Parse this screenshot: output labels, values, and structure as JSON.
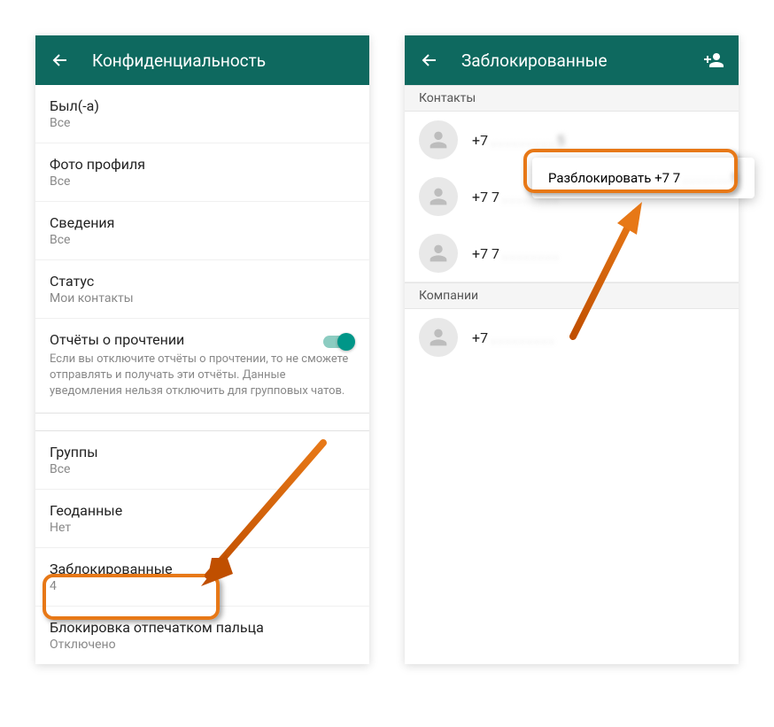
{
  "left": {
    "title": "Конфиденциальность",
    "items": {
      "lastSeen": {
        "title": "Был(-а)",
        "sub": "Все"
      },
      "photo": {
        "title": "Фото профиля",
        "sub": "Все"
      },
      "about": {
        "title": "Сведения",
        "sub": "Все"
      },
      "status": {
        "title": "Статус",
        "sub": "Мои контакты"
      },
      "readReceipts": {
        "title": "Отчёты о прочтении",
        "sub": "Если вы отключите отчёты о прочтении, то не сможете отправлять и получать эти отчёты. Данные уведомления нельзя отключить для групповых чатов."
      },
      "groups": {
        "title": "Группы",
        "sub": "Все"
      },
      "location": {
        "title": "Геоданные",
        "sub": "Нет"
      },
      "blocked": {
        "title": "Заблокированные",
        "sub": "4"
      },
      "fingerprint": {
        "title": "Блокировка отпечатком пальца",
        "sub": "Отключено"
      }
    }
  },
  "right": {
    "title": "Заблокированные",
    "sections": {
      "contacts": "Контакты",
      "companies": "Компании"
    },
    "contacts": [
      {
        "label": "+7",
        "rest": "  . . .   . . .   . . . 5"
      },
      {
        "label": "+7 7",
        "rest": " . . .   . . .    . . "
      },
      {
        "label": "+7 7",
        "rest": " . .   . . .   . . . "
      }
    ],
    "companies": [
      {
        "label": "+7",
        "rest": " . . .   . . .   . . . "
      }
    ],
    "contextMenu": "Разблокировать +7 7"
  }
}
